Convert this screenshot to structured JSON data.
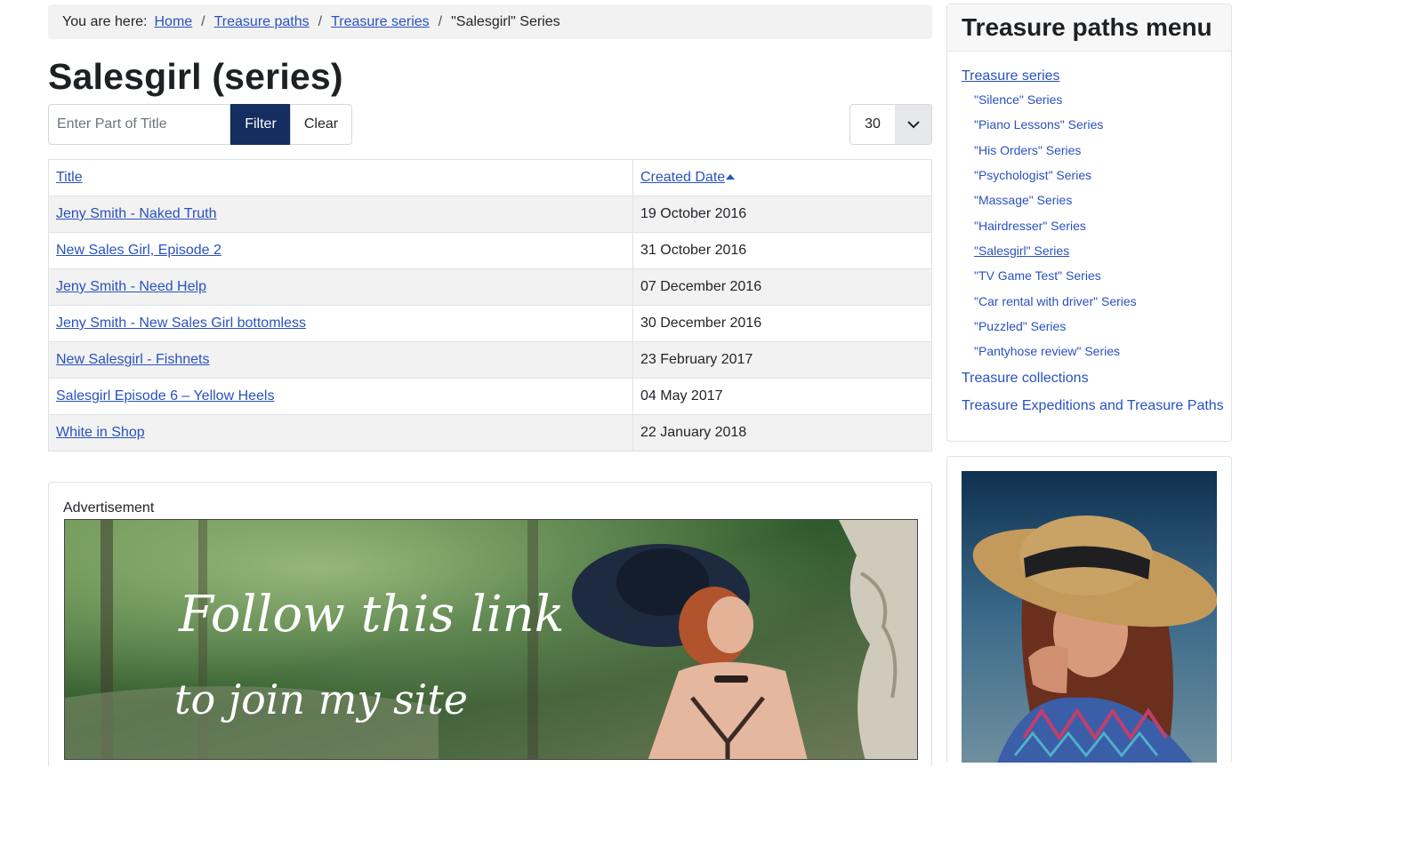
{
  "breadcrumb": {
    "prefix": "You are here:",
    "items": [
      "Home",
      "Treasure paths",
      "Treasure series"
    ],
    "current": "\"Salesgirl\" Series"
  },
  "page_title": "Salesgirl (series)",
  "filter": {
    "placeholder": "Enter Part of Title",
    "value": "",
    "filter_label": "Filter",
    "clear_label": "Clear",
    "limit_value": "30",
    "icon": "chevron-down-icon"
  },
  "table": {
    "headers": {
      "title": "Title",
      "created": "Created Date"
    },
    "sort_icon": "sort-asc-icon",
    "rows": [
      {
        "title": "Jeny Smith - Naked Truth",
        "date": "19 October 2016"
      },
      {
        "title": "New Sales Girl, Episode 2",
        "date": "31 October 2016"
      },
      {
        "title": "Jeny Smith - Need Help",
        "date": "07 December 2016"
      },
      {
        "title": "Jeny Smith - New Sales Girl bottomless",
        "date": "30 December 2016"
      },
      {
        "title": "New Salesgirl - Fishnets",
        "date": "23 February 2017"
      },
      {
        "title": "Salesgirl Episode 6 – Yellow Heels",
        "date": "04 May 2017"
      },
      {
        "title": "White in Shop",
        "date": "22 January 2018"
      }
    ]
  },
  "advertisement": {
    "label": "Advertisement",
    "line1": "Follow this link",
    "line2": "to join my site"
  },
  "sidebar": {
    "title": "Treasure paths menu",
    "series_link": "Treasure series",
    "series": [
      "\"Silence\" Series",
      "\"Piano Lessons\" Series",
      "\"His Orders\" Series",
      "\"Psychologist\" Series",
      "\"Massage\" Series",
      "\"Hairdresser\" Series",
      "\"Salesgirl\" Series",
      "\"TV Game Test\" Series",
      "\"Car rental with driver\" Series",
      "\"Puzzled\" Series",
      "\"Pantyhose review\" Series"
    ],
    "active_index": 6,
    "collections_link": "Treasure collections",
    "expeditions_link": "Treasure Expeditions and Treasure Paths"
  },
  "colors": {
    "link": "#2a52be",
    "primary_button": "#132e5f",
    "stripe": "#f2f2f2"
  }
}
